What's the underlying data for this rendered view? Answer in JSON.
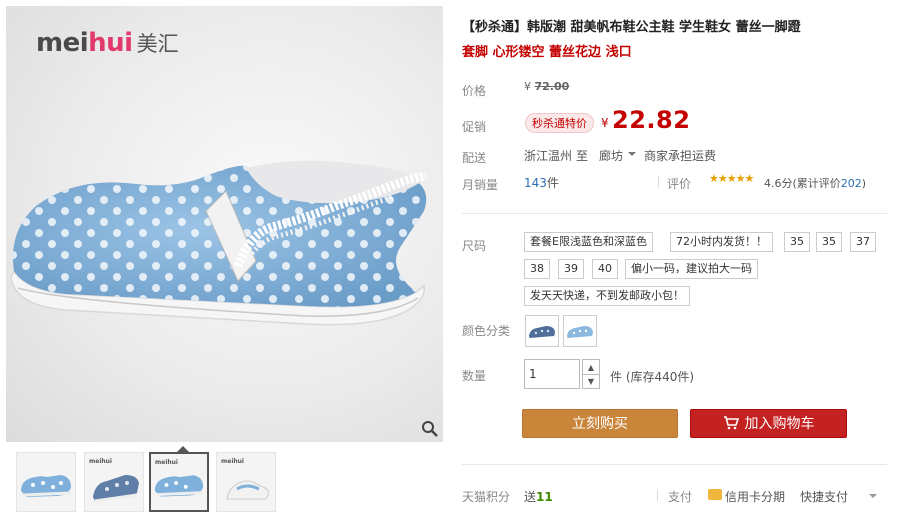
{
  "gallery": {
    "logo_latin_a": "mei",
    "logo_latin_b": "hui",
    "logo_cn": "美汇",
    "thumb_logo": "meihui"
  },
  "product": {
    "title": "【秒杀通】韩版潮 甜美帆布鞋公主鞋 学生鞋女 蕾丝一脚蹬",
    "subtitle": "套脚 心形镂空 蕾丝花边 浅口"
  },
  "price": {
    "label": "价格",
    "yen": "¥",
    "original": "72.00"
  },
  "promo": {
    "label": "促销",
    "tag": "秒杀通特价",
    "yen": "¥",
    "price": "22.82"
  },
  "shipping": {
    "label": "配送",
    "from": "浙江温州",
    "to_word": "至",
    "city": "廊坊",
    "fee": "商家承担运费"
  },
  "sales": {
    "label": "月销量",
    "count": "143",
    "unit": "件",
    "rating_label": "评价",
    "stars": "★★★★★",
    "score": "4.6分",
    "total_prefix": "(累计评价",
    "total_count": "202",
    "total_suffix": ")"
  },
  "size": {
    "label": "尺码",
    "options": [
      "套餐E限浅蓝色和深蓝色",
      "72小时内发货！！",
      "35",
      "35",
      "37",
      "38",
      "39",
      "40",
      "偏小一码，建议拍大一码",
      "发天天快递，不到发邮政小包！"
    ]
  },
  "color": {
    "label": "颜色分类"
  },
  "quantity": {
    "label": "数量",
    "value": "1",
    "unit_prefix": "件 (库存",
    "stock": "440",
    "unit_suffix": "件)"
  },
  "buttons": {
    "buy": "立刻购买",
    "cart": "加入购物车"
  },
  "bottom": {
    "points_label": "天猫积分",
    "points_prefix": "送",
    "points_value": "11",
    "pay_label": "支付",
    "credit": "信用卡分期",
    "quick_pay": "快捷支付"
  },
  "colors": {
    "accent_red": "#c40000",
    "buy_button": "#c9853a",
    "cart_button": "#c42121",
    "link_blue": "#2d6fb3"
  }
}
